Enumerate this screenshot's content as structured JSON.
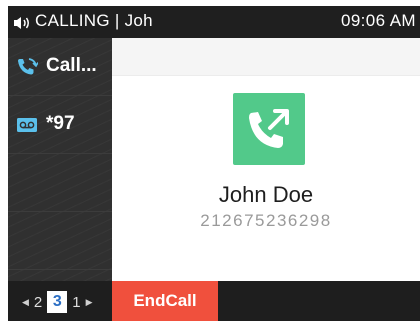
{
  "status_bar": {
    "title": "CALLING | Joh",
    "time": "09:06 AM",
    "speaker_icon": "speaker-volume-icon"
  },
  "sidebar": {
    "items": [
      {
        "icon": "call-transfer-icon",
        "label": "Call...",
        "icon_color": "#5bc0eb"
      },
      {
        "icon": "voicemail-icon",
        "label": "*97",
        "icon_color": "#5bc0eb"
      }
    ]
  },
  "call": {
    "icon": "outgoing-call-icon",
    "icon_bg": "#52c98a",
    "contact_name": "John Doe",
    "contact_number": "212675236298"
  },
  "pager": {
    "prev": "2",
    "current": "3",
    "next": "1"
  },
  "softkeys": {
    "end_call": "EndCall",
    "end_call_color": "#f0503d"
  }
}
